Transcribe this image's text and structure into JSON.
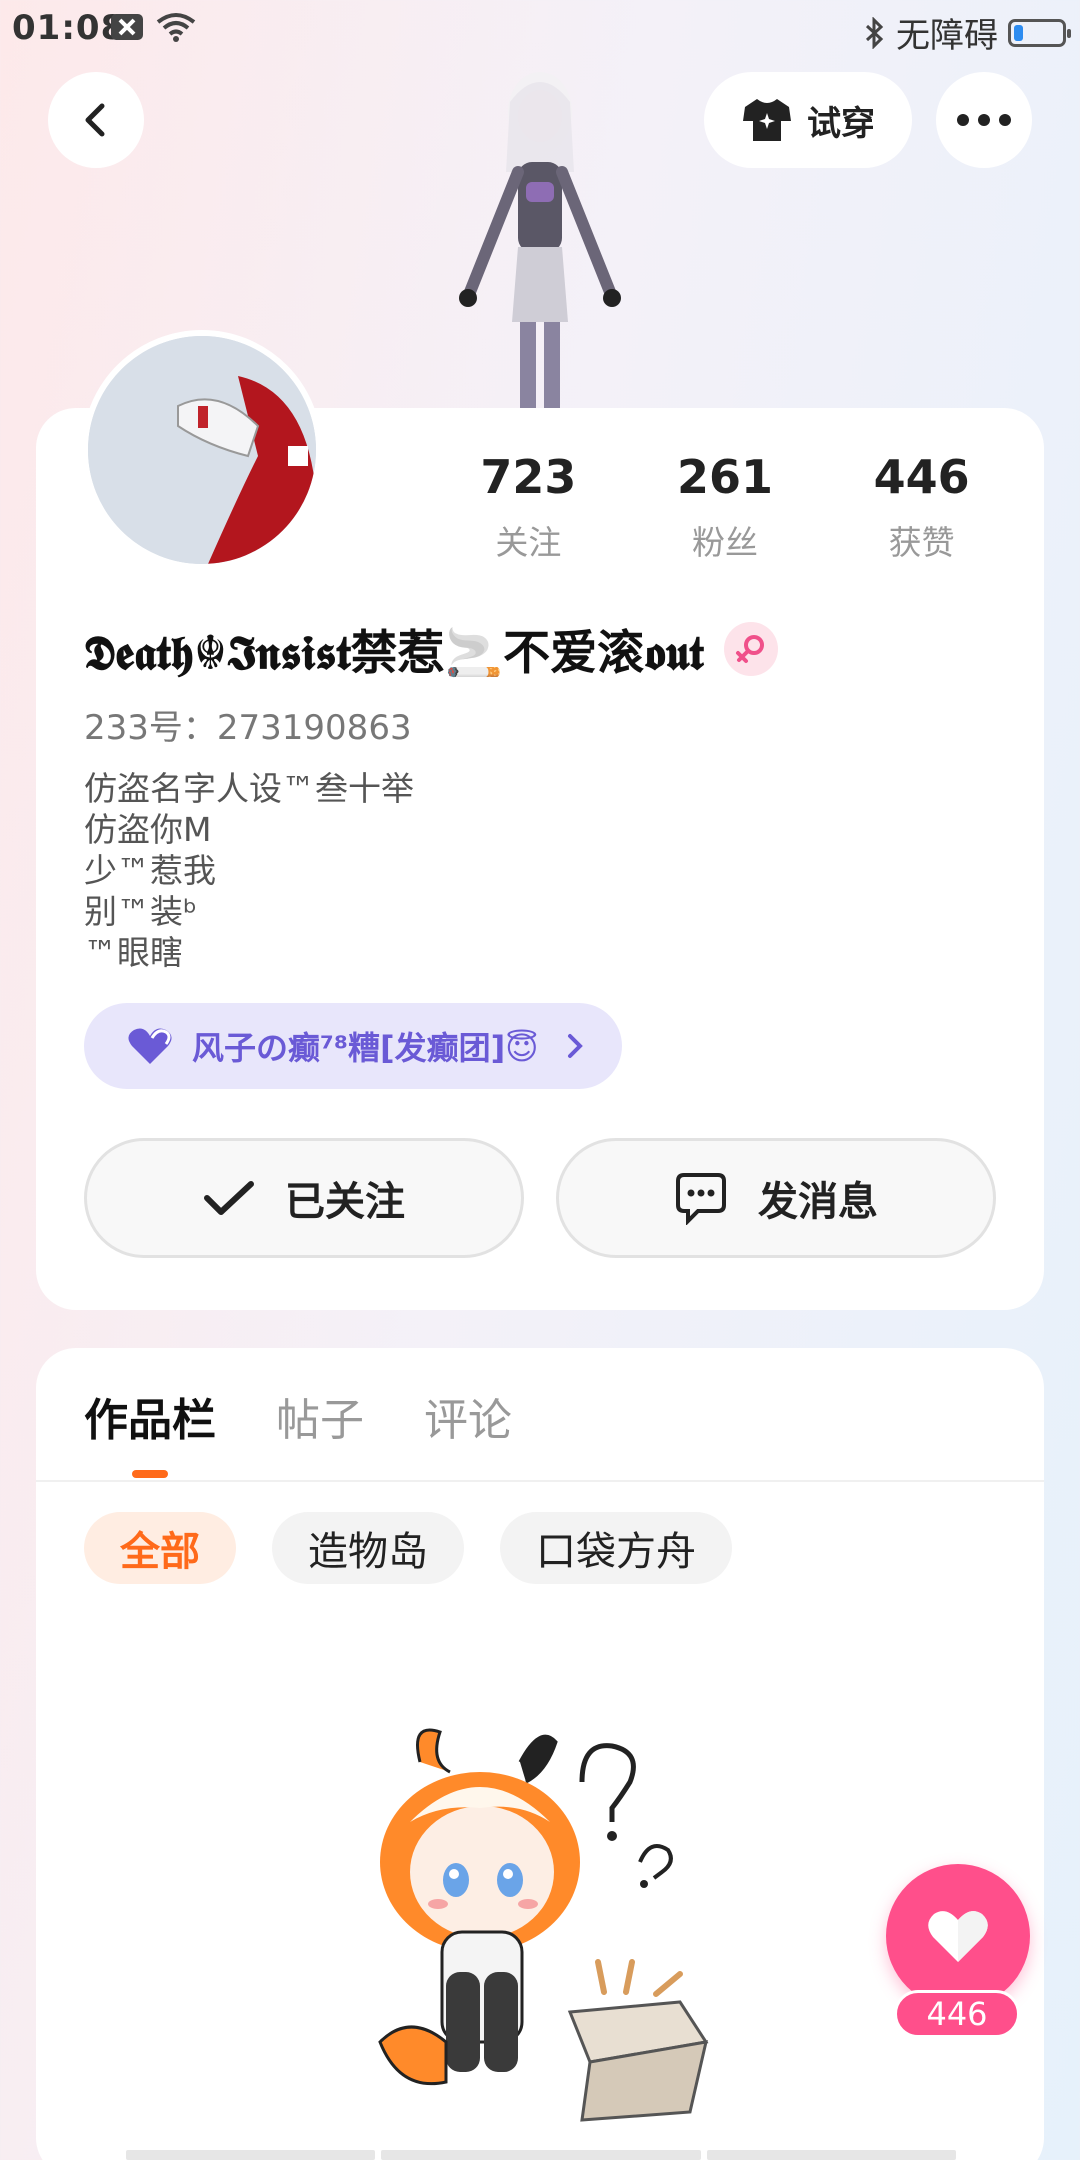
{
  "status_bar": {
    "time": "01:08",
    "accessibility": "无障碍",
    "battery_level": 0.2
  },
  "top_bar": {
    "try_on_label": "试穿"
  },
  "profile": {
    "stats": [
      {
        "value": "723",
        "label": "关注"
      },
      {
        "value": "261",
        "label": "粉丝"
      },
      {
        "value": "446",
        "label": "获赞"
      }
    ],
    "username": "𝕯𝖊𝖆𝖙𝖍☬𝕴𝖓𝖘𝖎𝖘𝖙禁惹🚬不爱滚𝖔𝖚𝖙",
    "gender": "female",
    "uid_text": "233号：273190863",
    "bio_lines": [
      "仿盗名字人设™叁十举",
      "仿盗你M",
      "少™惹我",
      "别™装ᵇ",
      "™眼瞎"
    ],
    "club_label": "风子の癫⁷⁸糟[发癫团]😇",
    "follow_label": "已关注",
    "message_label": "发消息"
  },
  "content": {
    "tabs": [
      {
        "label": "作品栏",
        "active": true
      },
      {
        "label": "帖子",
        "active": false
      },
      {
        "label": "评论",
        "active": false
      }
    ],
    "filters": [
      {
        "label": "全部",
        "active": true
      },
      {
        "label": "造物岛",
        "active": false
      },
      {
        "label": "口袋方舟",
        "active": false
      }
    ]
  },
  "like_fab": {
    "count": "446"
  },
  "colors": {
    "accent_orange": "#ff6a1a",
    "like_pink": "#ff4f8b",
    "club_purple": "#6a5ad6",
    "battery_blue": "#2d8cf0"
  },
  "icons": [
    "back-icon",
    "tshirt-icon",
    "more-dots-icon",
    "checkmark-icon",
    "chat-bubble-icon",
    "heart-icon",
    "female-icon",
    "purple-heart-icon",
    "chevron-right-icon"
  ]
}
